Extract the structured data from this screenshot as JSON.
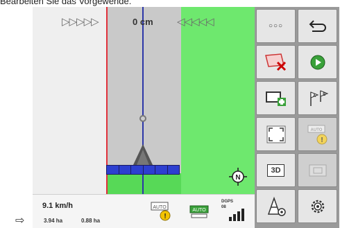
{
  "caption": {
    "text": "Bearbeiten Sie das Vorgewende."
  },
  "page_marker": {
    "glyph": "⇨"
  },
  "map": {
    "offset_label": "0 cm",
    "arrows_left": "▷▷▷▷▷",
    "arrows_right": "◁◁◁◁◁",
    "colors": {
      "worked": "#6ee86e",
      "lane": "#c9c9c9",
      "guide_red": "#e0303a",
      "guide_blue": "#2c36a8",
      "implement": "#2d3fd0"
    }
  },
  "status": {
    "speed": "9.1 km/h",
    "area_total": "3.94 ha",
    "area_worked": "0.88 ha",
    "auto_label": "AUTO",
    "auto_label_2": "AUTO",
    "gps_type": "DGPS",
    "satellites": "08"
  },
  "toolbar": {
    "more_label": "○○○",
    "view_3d_label": "3D",
    "auto_label": "AUTO",
    "icons": [
      "more-icon",
      "back-icon",
      "delete-boundary-icon",
      "play-icon",
      "add-field-icon",
      "ab-line-icon",
      "fullscreen-icon",
      "auto-steer-warning-icon",
      "view-3d-icon",
      "field-map-icon",
      "cone-settings-icon",
      "gear-icon"
    ]
  }
}
